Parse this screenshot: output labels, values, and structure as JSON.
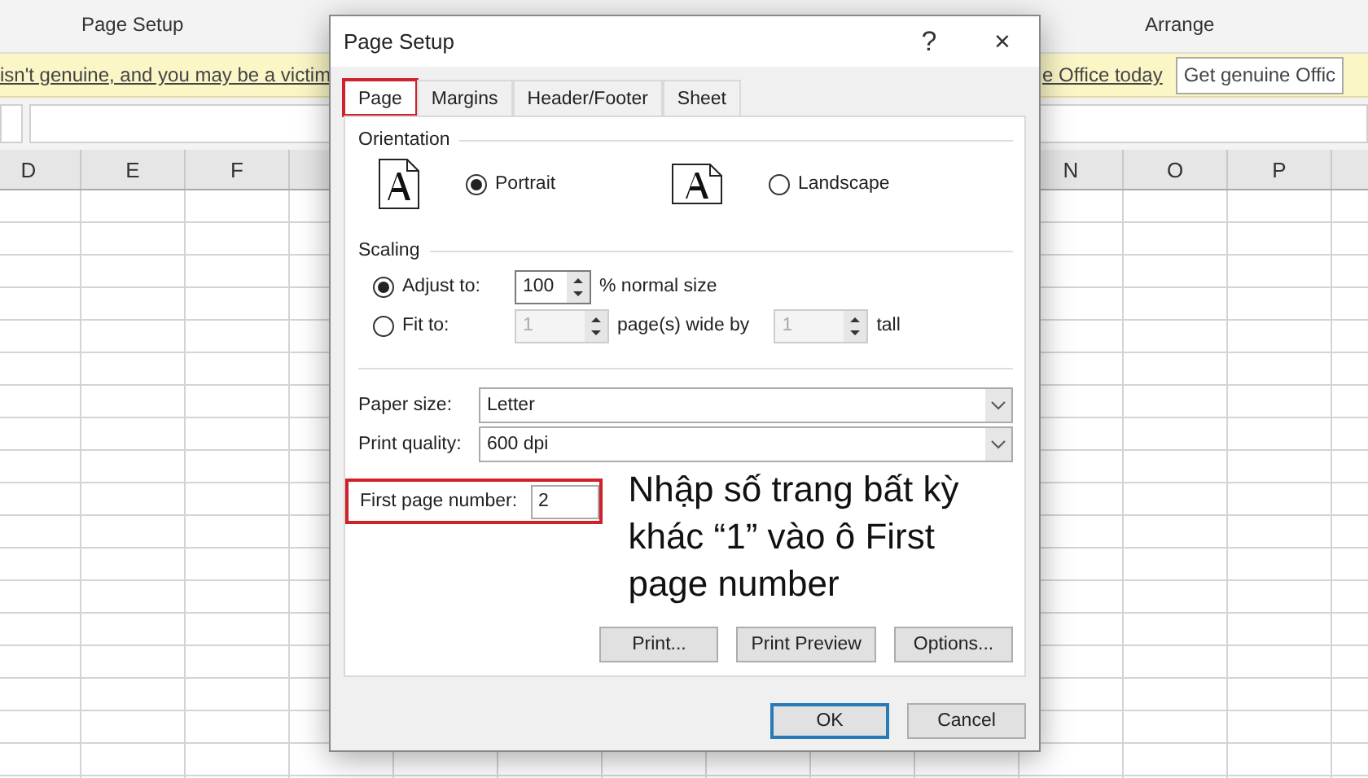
{
  "ribbon": {
    "groups": [
      {
        "label": "Page Setup"
      },
      {
        "label": "Arrange"
      }
    ]
  },
  "notice_bar": {
    "text_left": "isn't genuine, and you may be a victim",
    "text_right": "e Office today",
    "button": "Get genuine Offic"
  },
  "sheet": {
    "columns_left": [
      "D",
      "E",
      "F"
    ],
    "columns_right": [
      "N",
      "O",
      "P"
    ]
  },
  "dialog": {
    "title": "Page Setup",
    "help": "?",
    "close": "×",
    "tabs": [
      {
        "label": "Page",
        "selected": true,
        "highlighted": true
      },
      {
        "label": "Margins",
        "selected": false,
        "highlighted": false
      },
      {
        "label": "Header/Footer",
        "selected": false,
        "highlighted": false
      },
      {
        "label": "Sheet",
        "selected": false,
        "highlighted": false
      }
    ],
    "orientation": {
      "label": "Orientation",
      "options": [
        {
          "label": "Portrait",
          "selected": true,
          "kind": "portrait"
        },
        {
          "label": "Landscape",
          "selected": false,
          "kind": "landscape"
        }
      ]
    },
    "scaling": {
      "label": "Scaling",
      "adjust": {
        "label": "Adjust to:",
        "selected": true,
        "value": "100",
        "suffix": "% normal size"
      },
      "fit": {
        "label": "Fit to:",
        "selected": false,
        "wide": "1",
        "wide_label": "page(s) wide by",
        "tall": "1",
        "tall_label": "tall",
        "disabled": true
      }
    },
    "paper_size": {
      "label": "Paper size:",
      "value": "Letter"
    },
    "print_quality": {
      "label": "Print quality:",
      "value": "600 dpi"
    },
    "first_page": {
      "label": "First page number:",
      "value": "2",
      "highlighted": true
    },
    "note": "Nhập số trang bất kỳ khác “1” vào ô First page number",
    "buttons": [
      {
        "label": "Print..."
      },
      {
        "label": "Print Preview"
      },
      {
        "label": "Options..."
      }
    ],
    "footer_buttons": [
      {
        "label": "OK",
        "default": true
      },
      {
        "label": "Cancel",
        "default": false
      }
    ]
  }
}
